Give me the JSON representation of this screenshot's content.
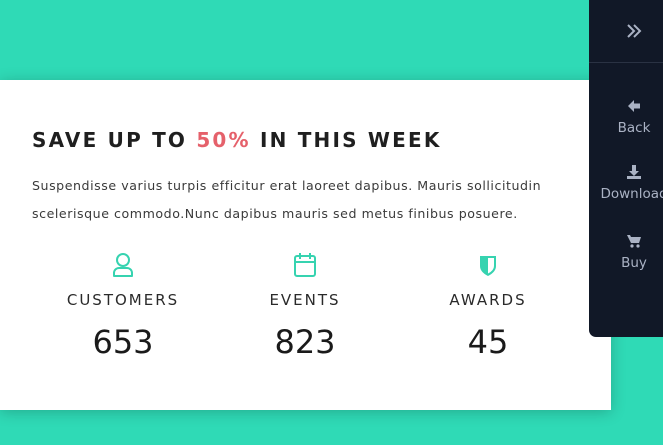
{
  "promo": {
    "headline_pre": "SAVE UP TO ",
    "headline_highlight": "50%",
    "headline_post": " IN THIS WEEK",
    "description": "Suspendisse varius turpis efficitur erat laoreet dapibus. Mauris sollicitudin scelerisque commodo.Nunc dapibus mauris sed metus finibus posuere."
  },
  "stats": [
    {
      "icon": "user-icon",
      "label": "CUSTOMERS",
      "value": "653"
    },
    {
      "icon": "calendar-icon",
      "label": "EVENTS",
      "value": "823"
    },
    {
      "icon": "shield-icon",
      "label": "AWARDS",
      "value": "45"
    }
  ],
  "sidebar": {
    "toggle_icon": "double-chevron-right-icon",
    "items": [
      {
        "icon": "arrow-left-icon",
        "label": "Back"
      },
      {
        "icon": "download-icon",
        "label": "Download"
      },
      {
        "icon": "cart-icon",
        "label": "Buy"
      }
    ]
  },
  "colors": {
    "background": "#2fdab6",
    "accent": "#36d3b0",
    "highlight": "#e5616b",
    "sidebar": "#111827"
  }
}
